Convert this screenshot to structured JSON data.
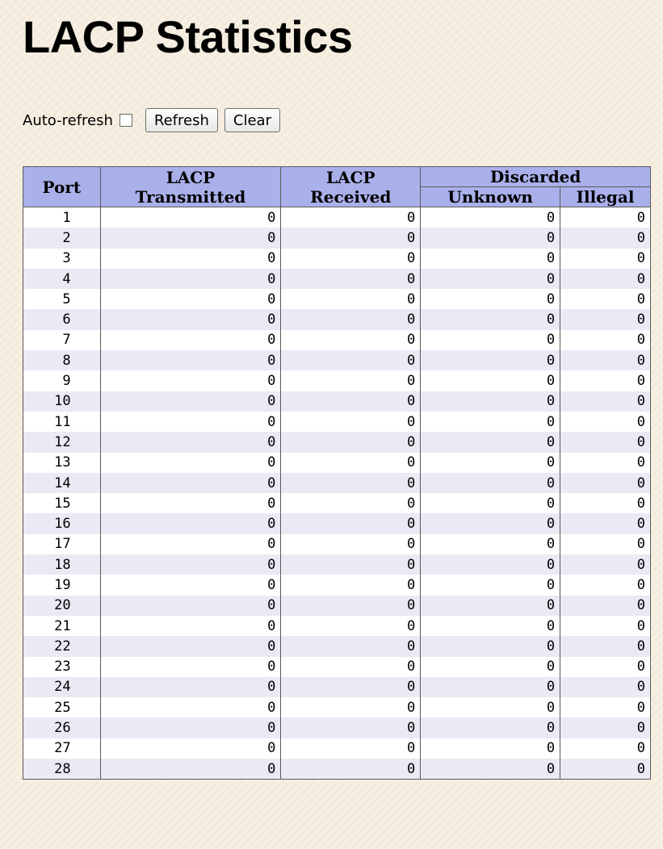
{
  "page": {
    "title": "LACP Statistics",
    "auto_refresh_label": "Auto-refresh",
    "auto_refresh_checked": false,
    "refresh_label": "Refresh",
    "clear_label": "Clear"
  },
  "table": {
    "headers": {
      "port": "Port",
      "lacp_transmitted": "LACP\nTransmitted",
      "lacp_received": "LACP\nReceived",
      "discarded": "Discarded",
      "unknown": "Unknown",
      "illegal": "Illegal"
    },
    "rows": [
      {
        "port": "1",
        "tx": "0",
        "rx": "0",
        "unknown": "0",
        "illegal": "0"
      },
      {
        "port": "2",
        "tx": "0",
        "rx": "0",
        "unknown": "0",
        "illegal": "0"
      },
      {
        "port": "3",
        "tx": "0",
        "rx": "0",
        "unknown": "0",
        "illegal": "0"
      },
      {
        "port": "4",
        "tx": "0",
        "rx": "0",
        "unknown": "0",
        "illegal": "0"
      },
      {
        "port": "5",
        "tx": "0",
        "rx": "0",
        "unknown": "0",
        "illegal": "0"
      },
      {
        "port": "6",
        "tx": "0",
        "rx": "0",
        "unknown": "0",
        "illegal": "0"
      },
      {
        "port": "7",
        "tx": "0",
        "rx": "0",
        "unknown": "0",
        "illegal": "0"
      },
      {
        "port": "8",
        "tx": "0",
        "rx": "0",
        "unknown": "0",
        "illegal": "0"
      },
      {
        "port": "9",
        "tx": "0",
        "rx": "0",
        "unknown": "0",
        "illegal": "0"
      },
      {
        "port": "10",
        "tx": "0",
        "rx": "0",
        "unknown": "0",
        "illegal": "0"
      },
      {
        "port": "11",
        "tx": "0",
        "rx": "0",
        "unknown": "0",
        "illegal": "0"
      },
      {
        "port": "12",
        "tx": "0",
        "rx": "0",
        "unknown": "0",
        "illegal": "0"
      },
      {
        "port": "13",
        "tx": "0",
        "rx": "0",
        "unknown": "0",
        "illegal": "0"
      },
      {
        "port": "14",
        "tx": "0",
        "rx": "0",
        "unknown": "0",
        "illegal": "0"
      },
      {
        "port": "15",
        "tx": "0",
        "rx": "0",
        "unknown": "0",
        "illegal": "0"
      },
      {
        "port": "16",
        "tx": "0",
        "rx": "0",
        "unknown": "0",
        "illegal": "0"
      },
      {
        "port": "17",
        "tx": "0",
        "rx": "0",
        "unknown": "0",
        "illegal": "0"
      },
      {
        "port": "18",
        "tx": "0",
        "rx": "0",
        "unknown": "0",
        "illegal": "0"
      },
      {
        "port": "19",
        "tx": "0",
        "rx": "0",
        "unknown": "0",
        "illegal": "0"
      },
      {
        "port": "20",
        "tx": "0",
        "rx": "0",
        "unknown": "0",
        "illegal": "0"
      },
      {
        "port": "21",
        "tx": "0",
        "rx": "0",
        "unknown": "0",
        "illegal": "0"
      },
      {
        "port": "22",
        "tx": "0",
        "rx": "0",
        "unknown": "0",
        "illegal": "0"
      },
      {
        "port": "23",
        "tx": "0",
        "rx": "0",
        "unknown": "0",
        "illegal": "0"
      },
      {
        "port": "24",
        "tx": "0",
        "rx": "0",
        "unknown": "0",
        "illegal": "0"
      },
      {
        "port": "25",
        "tx": "0",
        "rx": "0",
        "unknown": "0",
        "illegal": "0"
      },
      {
        "port": "26",
        "tx": "0",
        "rx": "0",
        "unknown": "0",
        "illegal": "0"
      },
      {
        "port": "27",
        "tx": "0",
        "rx": "0",
        "unknown": "0",
        "illegal": "0"
      },
      {
        "port": "28",
        "tx": "0",
        "rx": "0",
        "unknown": "0",
        "illegal": "0"
      }
    ]
  },
  "colors": {
    "header_bg": "#aab0ea",
    "row_odd": "#ffffff",
    "row_even": "#ece8f4",
    "page_bg": "#f6efe2"
  }
}
